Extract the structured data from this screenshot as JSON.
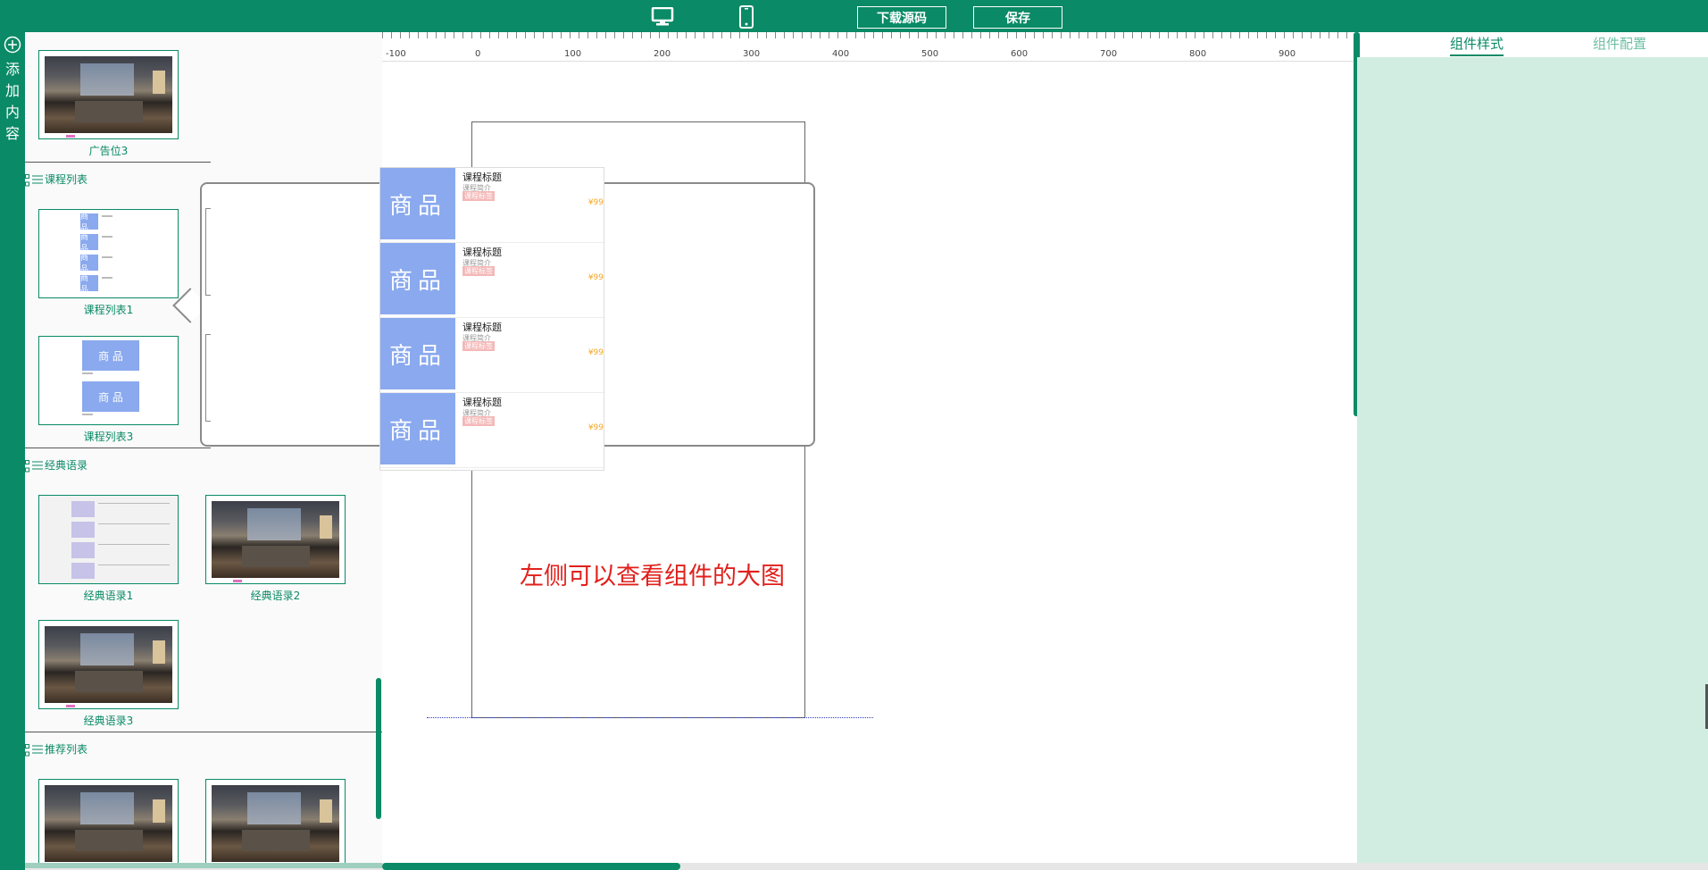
{
  "toolbar": {
    "desktop_icon": "desktop-icon",
    "mobile_icon": "mobile-icon",
    "download_label": "下载源码",
    "save_label": "保存"
  },
  "sidebar": {
    "add_icon": "plus-circle-icon",
    "add_label": [
      "添",
      "加",
      "内",
      "容"
    ]
  },
  "panel": {
    "items_top": {
      "label": "广告位3"
    },
    "category_course": {
      "label": "课程列表"
    },
    "course1": {
      "label": "课程列表1"
    },
    "course3": {
      "label": "课程列表3"
    },
    "category_quotes": {
      "label": "经典语录"
    },
    "quote1": {
      "label": "经典语录1"
    },
    "quote2": {
      "label": "经典语录2"
    },
    "quote3": {
      "label": "经典语录3"
    },
    "category_recommend": {
      "label": "推荐列表"
    },
    "mini_goods": "商 品"
  },
  "ruler": {
    "labels": [
      "-100",
      "0",
      "100",
      "200",
      "300",
      "400",
      "500",
      "600",
      "700",
      "800",
      "900"
    ]
  },
  "preview": {
    "courses": [
      {
        "goods": "商品",
        "title": "课程标题",
        "intro": "课程简介",
        "tag": "课程标签",
        "price": "¥99"
      },
      {
        "goods": "商品",
        "title": "课程标题",
        "intro": "课程简介",
        "tag": "课程标签",
        "price": "¥99"
      },
      {
        "goods": "商品",
        "title": "课程标题",
        "intro": "课程简介",
        "tag": "课程标签",
        "price": "¥99"
      },
      {
        "goods": "商品",
        "title": "课程标题",
        "intro": "课程简介",
        "tag": "课程标签",
        "price": "¥99"
      }
    ]
  },
  "canvas": {
    "hint": "左侧可以查看组件的大图"
  },
  "rightpanel": {
    "tab_style": "组件样式",
    "tab_config": "组件配置"
  },
  "colors": {
    "brand": "#0a8a66",
    "panel_bg": "#d1ede2",
    "goods_blue": "#8aa9ee",
    "hint_red": "#e0201c",
    "price_orange": "#f5a623"
  }
}
